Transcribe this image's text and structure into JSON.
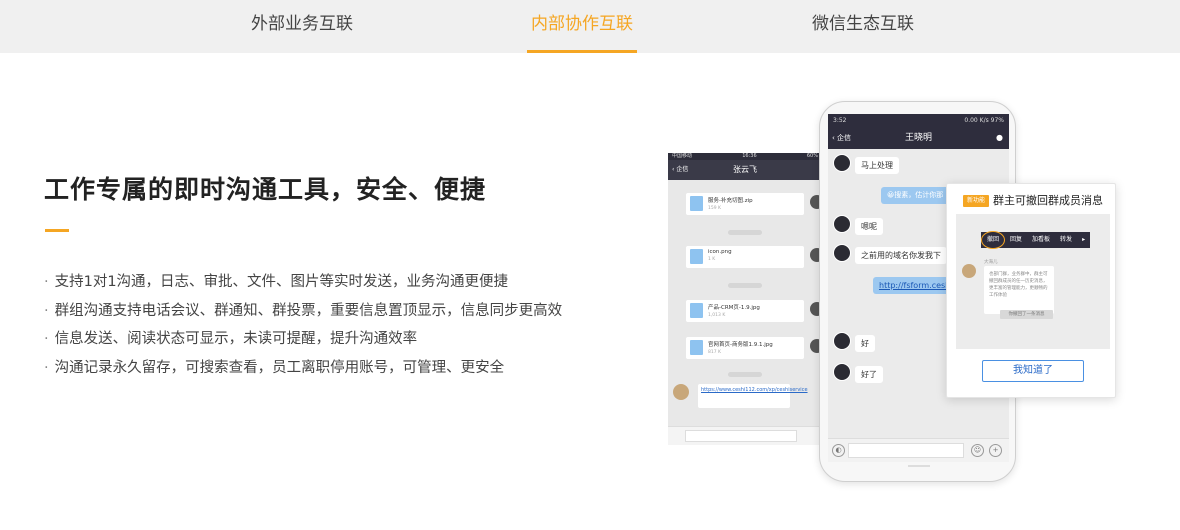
{
  "tabs": [
    {
      "label": "外部业务互联",
      "active": false
    },
    {
      "label": "内部协作互联",
      "active": true
    },
    {
      "label": "微信生态互联",
      "active": false
    }
  ],
  "headline": "工作专属的即时沟通工具，安全、便捷",
  "features": [
    "支持1对1沟通，日志、审批、文件、图片等实时发送，业务沟通更便捷",
    "群组沟通支持电话会议、群通知、群投票，重要信息置顶显示，信息同步更高效",
    "信息发送、阅读状态可显示，未读可提醒，提升沟通效率",
    "沟通记录永久留存，可搜索查看，员工离职停用账号，可管理、更安全"
  ],
  "feature_bullet": "·",
  "phone_back": {
    "status_left": "中国移动",
    "status_time": "16:36",
    "status_right": "60%",
    "back_label": "企信",
    "title": "张云飞",
    "files": [
      {
        "name": "服务-补充切图.zip",
        "size": "159 K"
      },
      {
        "name": "icon.png",
        "size": "1 K"
      },
      {
        "name": "产品-CRM页-1.9.jpg",
        "size": "1,013 K"
      },
      {
        "name": "官网首页-商务版1.9.1.jpg",
        "size": "817 K"
      }
    ],
    "link": "https://www.ceshi112.com/xp/ceshiservice"
  },
  "phone_front": {
    "status_time": "3:52",
    "status_speed": "0.00 K/s",
    "status_battery": "97%",
    "back_label": "企信",
    "title": "王晓明",
    "messages": [
      {
        "from": "other",
        "text": "马上处理"
      },
      {
        "from": "me",
        "text": "😀搜素，估计你那"
      },
      {
        "from": "other",
        "text": "嗯呢"
      },
      {
        "from": "other",
        "text": "之前用的域名你发我下"
      },
      {
        "from": "me",
        "text": "http://fsform.ceshi"
      },
      {
        "from": "other",
        "text": "好"
      },
      {
        "from": "other",
        "text": "好了"
      }
    ]
  },
  "popup": {
    "tag": "新功能",
    "title": "群主可撤回群成员消息",
    "menu": [
      "撤回",
      "回复",
      "加看板",
      "转发",
      "▸"
    ],
    "sender": "大海儿",
    "message": "也部门群，业务群中，群主可撤回群成员的任一历史消息，更丰富的管理能力，更顺畅的工作体验",
    "recalled_note": "你撤回了一条消息",
    "button": "我知道了"
  }
}
